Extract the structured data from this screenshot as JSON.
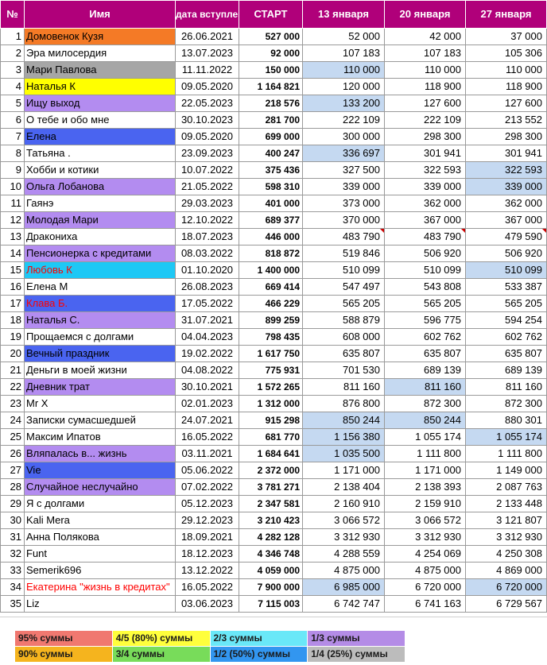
{
  "headers": {
    "num": "№",
    "name": "Имя",
    "joined": "дата вступления",
    "start": "СТАРТ",
    "c1": "13 января",
    "c2": "20 января",
    "c3": "27 января"
  },
  "colors": {
    "header_bg": "#b0007a",
    "orange": "#f47a26",
    "gray": "#a6a6a6",
    "yellow": "#ffff00",
    "purple": "#b38cf0",
    "blue": "#4a64f0",
    "cyan": "#1ec8f5",
    "light_blue": "#c5d9f1",
    "red_text": "#ff0000"
  },
  "rows": [
    {
      "n": "1",
      "name": "Домовенок Кузя",
      "date": "26.06.2021",
      "start": "527 000",
      "v1": "52 000",
      "v2": "42 000",
      "v3": "37 000",
      "bg": "orange"
    },
    {
      "n": "2",
      "name": "Эра милосердия",
      "date": "13.07.2023",
      "start": "92 000",
      "v1": "107 183",
      "v2": "107 183",
      "v3": "105 306"
    },
    {
      "n": "3",
      "name": "Мари Павлова",
      "date": "11.11.2022",
      "start": "150 000",
      "v1": "110 000",
      "v2": "110 000",
      "v3": "110 000",
      "bg": "gray",
      "h": [
        1
      ]
    },
    {
      "n": "4",
      "name": "Наталья К",
      "date": "09.05.2020",
      "start": "1 164 821",
      "v1": "120 000",
      "v2": "118 900",
      "v3": "118 900",
      "bg": "yellow"
    },
    {
      "n": "5",
      "name": "Ищу выход",
      "date": "22.05.2023",
      "start": "218 576",
      "v1": "133 200",
      "v2": "127 600",
      "v3": "127 600",
      "bg": "purple",
      "h": [
        1
      ]
    },
    {
      "n": "6",
      "name": "О тебе и обо мне",
      "date": "30.10.2023",
      "start": "281 700",
      "v1": "222 109",
      "v2": "222 109",
      "v3": "213 552"
    },
    {
      "n": "7",
      "name": "Елена",
      "date": "09.05.2020",
      "start": "699 000",
      "v1": "300 000",
      "v2": "298 300",
      "v3": "298 300",
      "bg": "blue"
    },
    {
      "n": "8",
      "name": "Татьяна .",
      "date": "23.09.2023",
      "start": "400 247",
      "v1": "336 697",
      "v2": "301 941",
      "v3": "301 941",
      "h": [
        1
      ]
    },
    {
      "n": "9",
      "name": "Хобби и котики",
      "date": "10.07.2022",
      "start": "375 436",
      "v1": "327 500",
      "v2": "322 593",
      "v3": "322 593",
      "h": [
        3
      ]
    },
    {
      "n": "10",
      "name": "Ольга Лобанова",
      "date": "21.05.2022",
      "start": "598 310",
      "v1": "339 000",
      "v2": "339 000",
      "v3": "339 000",
      "bg": "purple",
      "h": [
        3
      ]
    },
    {
      "n": "11",
      "name": "Гаянэ",
      "date": "29.03.2023",
      "start": "401 000",
      "v1": "373 000",
      "v2": "362 000",
      "v3": "362 000"
    },
    {
      "n": "12",
      "name": "Молодая Мари",
      "date": "12.10.2022",
      "start": "689 377",
      "v1": "370 000",
      "v2": "367 000",
      "v3": "367 000",
      "bg": "purple"
    },
    {
      "n": "13",
      "name": "Дракониха",
      "date": "18.07.2023",
      "start": "446 000",
      "v1": "483 790",
      "v2": "483 790",
      "v3": "479 590",
      "t": [
        1,
        2,
        3
      ]
    },
    {
      "n": "14",
      "name": "Пенсионерка с кредитами",
      "date": "08.03.2022",
      "start": "818 872",
      "v1": "519 846",
      "v2": "506 920",
      "v3": "506 920",
      "bg": "purple"
    },
    {
      "n": "15",
      "name": "Любовь К",
      "date": "01.10.2020",
      "start": "1 400 000",
      "v1": "510 099",
      "v2": "510 099",
      "v3": "510 099",
      "bg": "cyan",
      "red": true,
      "h": [
        3
      ]
    },
    {
      "n": "16",
      "name": "Елена М",
      "date": "26.08.2023",
      "start": "669 414",
      "v1": "547 497",
      "v2": "543 808",
      "v3": "533 387"
    },
    {
      "n": "17",
      "name": "Клава Б.",
      "date": "17.05.2022",
      "start": "466 229",
      "v1": "565 205",
      "v2": "565 205",
      "v3": "565 205",
      "bg": "blue",
      "red": true
    },
    {
      "n": "18",
      "name": "Наталья С.",
      "date": "31.07.2021",
      "start": "899 259",
      "v1": "588 879",
      "v2": "596 775",
      "v3": "594 254",
      "bg": "purple"
    },
    {
      "n": "19",
      "name": "Прощаемся с долгами",
      "date": "04.04.2023",
      "start": "798 435",
      "v1": "608 000",
      "v2": "602 762",
      "v3": "602 762"
    },
    {
      "n": "20",
      "name": "Вечный праздник",
      "date": "19.02.2022",
      "start": "1 617 750",
      "v1": "635 807",
      "v2": "635 807",
      "v3": "635 807",
      "bg": "blue"
    },
    {
      "n": "21",
      "name": "Деньги в моей жизни",
      "date": "04.08.2022",
      "start": "775 931",
      "v1": "701 530",
      "v2": "689 139",
      "v3": "689 139"
    },
    {
      "n": "22",
      "name": "Дневник трат",
      "date": "30.10.2021",
      "start": "1 572 265",
      "v1": "811 160",
      "v2": "811 160",
      "v3": "811 160",
      "bg": "purple",
      "h": [
        2
      ]
    },
    {
      "n": "23",
      "name": "Mr X",
      "date": "02.01.2023",
      "start": "1 312 000",
      "v1": "876 800",
      "v2": "872 300",
      "v3": "872 300"
    },
    {
      "n": "24",
      "name": "Записки сумасшедшей",
      "date": "24.07.2021",
      "start": "915 298",
      "v1": "850 244",
      "v2": "850 244",
      "v3": "880 301",
      "h": [
        1,
        2
      ]
    },
    {
      "n": "25",
      "name": "Максим Ипатов",
      "date": "16.05.2022",
      "start": "681 770",
      "v1": "1 156 380",
      "v2": "1 055 174",
      "v3": "1 055 174",
      "h": [
        1,
        3
      ]
    },
    {
      "n": "26",
      "name": "Вляпалась в... жизнь",
      "date": "03.11.2021",
      "start": "1 684 641",
      "v1": "1 035 500",
      "v2": "1 111 800",
      "v3": "1 111 800",
      "bg": "purple",
      "h": [
        1
      ]
    },
    {
      "n": "27",
      "name": "Vie",
      "date": "05.06.2022",
      "start": "2 372 000",
      "v1": "1 171 000",
      "v2": "1 171 000",
      "v3": "1 149 000",
      "bg": "blue"
    },
    {
      "n": "28",
      "name": "Случайное неслучайно",
      "date": "07.02.2022",
      "start": "3 781 271",
      "v1": "2 138 404",
      "v2": "2 138 393",
      "v3": "2 087 763",
      "bg": "purple"
    },
    {
      "n": "29",
      "name": "Я с долгами",
      "date": "05.12.2023",
      "start": "2 347 581",
      "v1": "2 160 910",
      "v2": "2 159 910",
      "v3": "2 133 448"
    },
    {
      "n": "30",
      "name": "Kali Mera",
      "date": "29.12.2023",
      "start": "3 210 423",
      "v1": "3 066 572",
      "v2": "3 066 572",
      "v3": "3 121 807"
    },
    {
      "n": "31",
      "name": "Анна Полякова",
      "date": "18.09.2021",
      "start": "4 282 128",
      "v1": "3 312 930",
      "v2": "3 312 930",
      "v3": "3 312 930"
    },
    {
      "n": "32",
      "name": "Funt",
      "date": "18.12.2023",
      "start": "4 346 748",
      "v1": "4 288 559",
      "v2": "4 254 069",
      "v3": "4 250 308"
    },
    {
      "n": "33",
      "name": "Semerik696",
      "date": "13.12.2022",
      "start": "4 059 000",
      "v1": "4 875 000",
      "v2": "4 875 000",
      "v3": "4 869 000"
    },
    {
      "n": "34",
      "name": "Екатерина \"жизнь в кредитах\"",
      "date": "16.05.2022",
      "start": "7 900 000",
      "v1": "6 985 000",
      "v2": "6 720 000",
      "v3": "6 720 000",
      "red": true,
      "h": [
        1,
        3
      ]
    },
    {
      "n": "35",
      "name": "Liz",
      "date": "03.06.2023",
      "start": "7 115 003",
      "v1": "6 742 747",
      "v2": "6 741 163",
      "v3": "6 729 567"
    }
  ],
  "legend": [
    [
      {
        "text": "95% суммы",
        "color": "#f07870"
      },
      {
        "text": "4/5 (80%) суммы",
        "color": "#ffff3c"
      },
      {
        "text": "2/3 суммы",
        "color": "#6ae8f8"
      },
      {
        "text": "1/3 суммы",
        "color": "#b48ce6"
      }
    ],
    [
      {
        "text": "90% суммы",
        "color": "#f5b41e"
      },
      {
        "text": "3/4 суммы",
        "color": "#78dc5a"
      },
      {
        "text": "1/2 (50%) суммы",
        "color": "#3296f0"
      },
      {
        "text": "1/4 (25%) суммы",
        "color": "#bcbcbc"
      }
    ]
  ]
}
